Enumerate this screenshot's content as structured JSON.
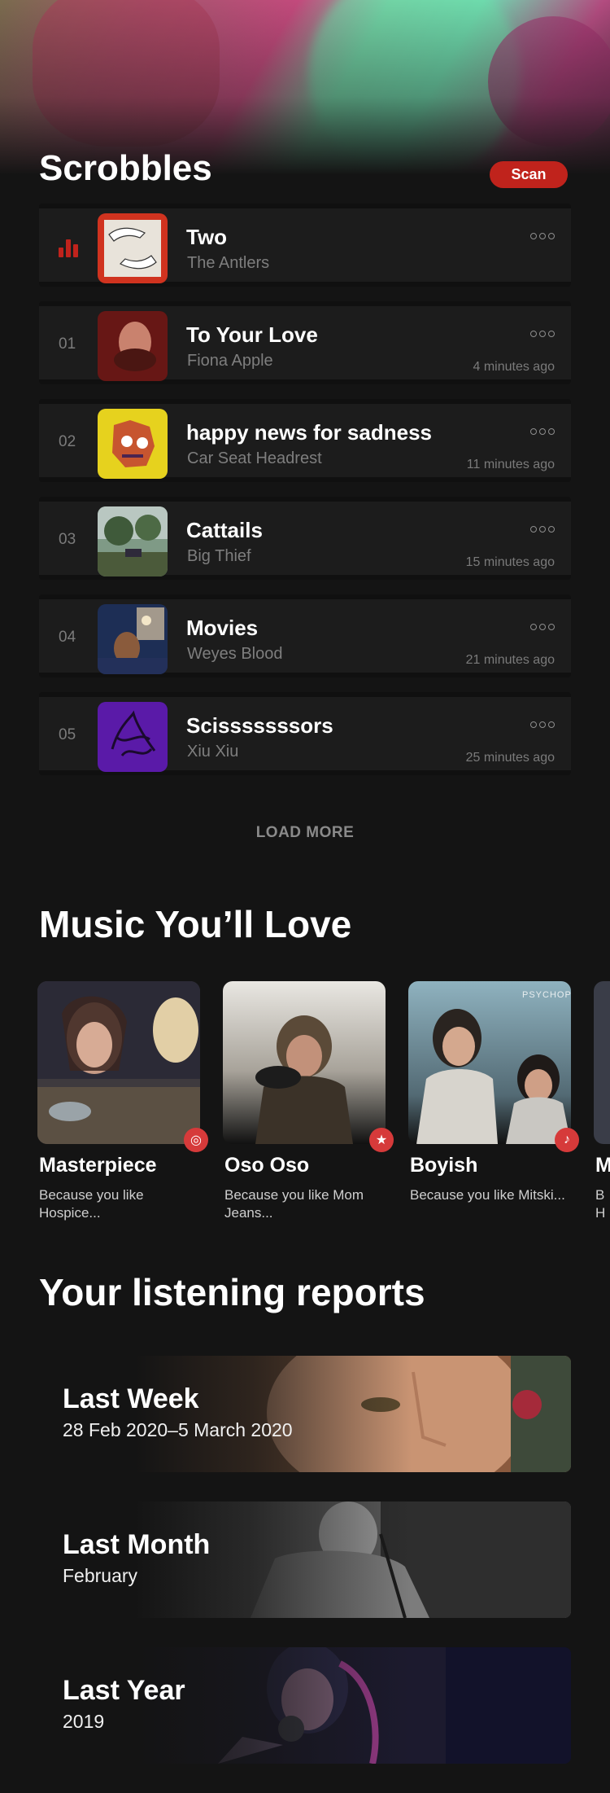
{
  "scrobbles": {
    "title": "Scrobbles",
    "scan_label": "Scan",
    "now_playing": {
      "title": "Two",
      "artist": "The Antlers"
    },
    "history": [
      {
        "rank": "01",
        "title": "To Your Love",
        "artist": "Fiona Apple",
        "time": "4 minutes ago"
      },
      {
        "rank": "02",
        "title": "happy news for sadness",
        "artist": "Car Seat Headrest",
        "time": "11 minutes ago"
      },
      {
        "rank": "03",
        "title": "Cattails",
        "artist": "Big Thief",
        "time": "15 minutes ago"
      },
      {
        "rank": "04",
        "title": "Movies",
        "artist": "Weyes Blood",
        "time": "21 minutes ago"
      },
      {
        "rank": "05",
        "title": "Scisssssssors",
        "artist": "Xiu Xiu",
        "time": "25 minutes ago"
      }
    ],
    "load_more_label": "LOAD MORE"
  },
  "love": {
    "title": "Music You’ll Love",
    "cards": [
      {
        "name": "Masterpiece",
        "reason": "Because you like Hospice...",
        "badge_icon": "radio-icon"
      },
      {
        "name": "Oso Oso",
        "reason": "Because you like Mom Jeans...",
        "badge_icon": "star-icon"
      },
      {
        "name": "Boyish",
        "reason": "Because you like Mitski...",
        "badge_icon": "music-note-icon",
        "cover_text": "PSYCHOPOMP"
      },
      {
        "name": "M",
        "reason": "B H",
        "badge_icon": ""
      }
    ]
  },
  "reports": {
    "title": "Your listening reports",
    "items": [
      {
        "label": "Last Week",
        "range": "28 Feb 2020–5 March 2020"
      },
      {
        "label": "Last Month",
        "range": "February"
      },
      {
        "label": "Last Year",
        "range": "2019"
      }
    ]
  },
  "colors": {
    "accent": "#c0231c",
    "background": "#141414",
    "badge": "#d63a3a"
  }
}
